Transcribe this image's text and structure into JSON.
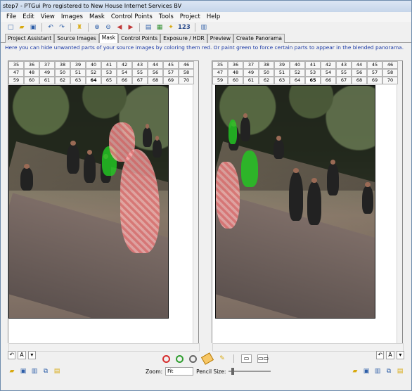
{
  "window": {
    "title": "step7 - PTGui Pro registered to New House Internet Services BV"
  },
  "menubar": {
    "items": [
      "File",
      "Edit",
      "View",
      "Images",
      "Mask",
      "Control Points",
      "Tools",
      "Project",
      "Help"
    ]
  },
  "toolbar": {
    "text_123": "123"
  },
  "tabs": [
    "Project Assistant",
    "Source Images",
    "Mask",
    "Control Points",
    "Exposure / HDR",
    "Preview",
    "Create Panorama"
  ],
  "active_tab": "Mask",
  "instruction": "Here you can hide unwanted parts of your source images by coloring them red. Or paint green to force certain parts to appear in the blended panorama.",
  "left_panel": {
    "rows": [
      [
        "35",
        "36",
        "37",
        "38",
        "39",
        "40",
        "41",
        "42",
        "43",
        "44",
        "45",
        "46"
      ],
      [
        "47",
        "48",
        "49",
        "50",
        "51",
        "52",
        "53",
        "54",
        "55",
        "56",
        "57",
        "58"
      ],
      [
        "59",
        "60",
        "61",
        "62",
        "63",
        "64",
        "65",
        "66",
        "67",
        "68",
        "69",
        "70"
      ]
    ],
    "active": "64"
  },
  "right_panel": {
    "rows": [
      [
        "35",
        "36",
        "37",
        "38",
        "39",
        "40",
        "41",
        "42",
        "43",
        "44",
        "45",
        "46"
      ],
      [
        "47",
        "48",
        "49",
        "50",
        "51",
        "52",
        "53",
        "54",
        "55",
        "56",
        "57",
        "58"
      ],
      [
        "59",
        "60",
        "61",
        "62",
        "63",
        "64",
        "65",
        "66",
        "67",
        "68",
        "69",
        "70"
      ]
    ],
    "active": "65"
  },
  "bottom": {
    "zoom_label": "Zoom:",
    "zoom_value": "Fit",
    "pencil_label": "Pencil Size:",
    "left_mode": "A",
    "right_mode": "A"
  }
}
